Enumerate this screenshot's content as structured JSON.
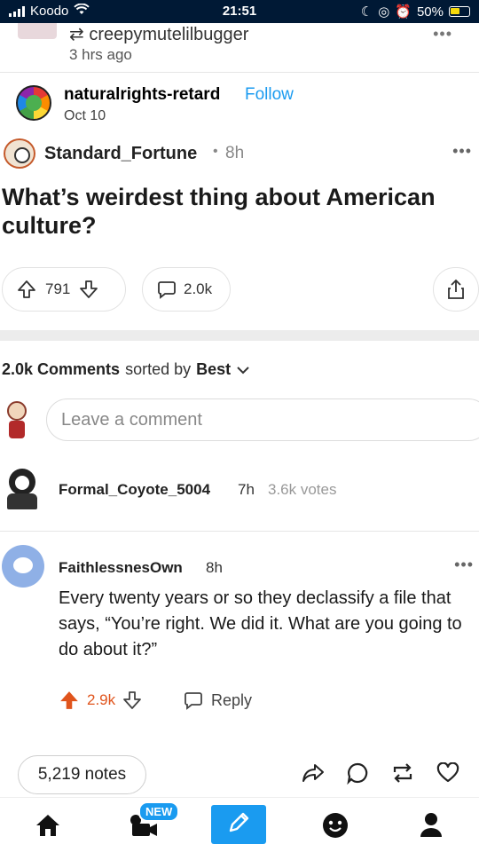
{
  "status_bar": {
    "carrier": "Koodo",
    "time": "21:51",
    "battery": "50%"
  },
  "reblog": {
    "username": "creepymutelilbugger",
    "time": "3 hrs ago",
    "more_icon": "more-dots-icon"
  },
  "op": {
    "username": "naturalrights-retard",
    "follow_label": "Follow",
    "date": "Oct 10"
  },
  "reddit": {
    "post": {
      "username": "Standard_Fortune",
      "age": "8h",
      "title": "What’s weirdest thing about American culture?",
      "votes": "791",
      "comments": "2.0k"
    },
    "sort": {
      "count_label": "2.0k Comments",
      "sorted_by": "sorted by",
      "sort_value": "Best"
    },
    "comment_input": {
      "placeholder": "Leave a comment"
    },
    "collapsed_comment": {
      "username": "Formal_Coyote_5004",
      "age": "7h",
      "votes": "3.6k votes"
    },
    "comment": {
      "username": "FaithlessnesOwn",
      "age": "8h",
      "body": "Every twenty years or so they declassify a file that says, “You’re right. We did it. What are you going to do about it?”",
      "score": "2.9k",
      "reply_label": "Reply"
    }
  },
  "footer": {
    "notes": "5,219 notes"
  },
  "navbar": {
    "new_badge": "NEW"
  },
  "colors": {
    "tumblr_navy": "#001935",
    "tumblr_blue": "#1a9bf0",
    "upvote_orange": "#e0541c"
  }
}
